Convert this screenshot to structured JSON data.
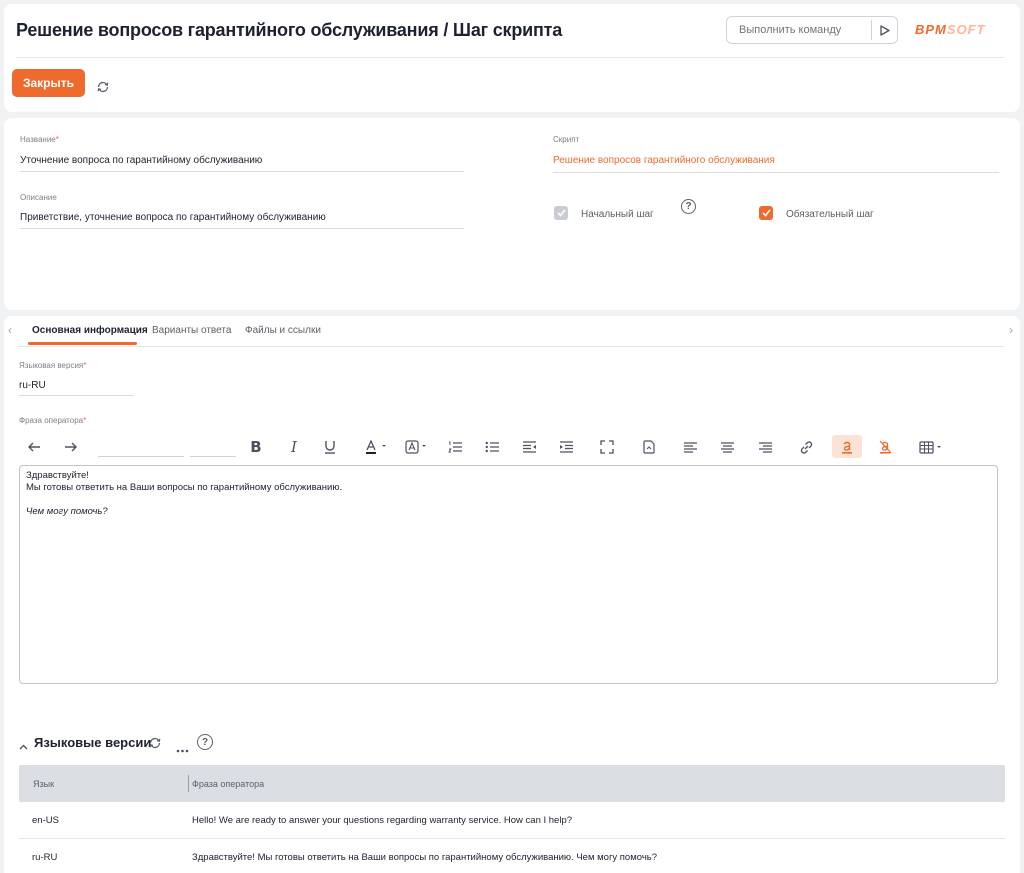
{
  "header": {
    "title": "Решение вопросов гарантийного обслуживания / Шаг скрипта",
    "command_placeholder": "Выполнить команду",
    "logo_main": "ВРМ",
    "logo_soft": "SOFT",
    "close_label": "Закрыть"
  },
  "form": {
    "name_label": "Название",
    "name_value": "Уточнение вопроса по гарантийному обслуживанию",
    "description_label": "Описание",
    "description_value": "Приветствие, уточнение вопроса по гарантийному обслуживанию",
    "script_label": "Скрипт",
    "script_value": "Решение вопросов гарантийного обслуживания",
    "initial_step_label": "Начальный шаг",
    "initial_step_checked": true,
    "mandatory_step_label": "Обязательный шаг",
    "mandatory_step_checked": true,
    "help_glyph": "?"
  },
  "tabs": [
    {
      "label": "Основная информация",
      "active": true
    },
    {
      "label": "Варианты ответа",
      "active": false
    },
    {
      "label": "Файлы и ссылки",
      "active": false
    }
  ],
  "main": {
    "language_label": "Языковая версия",
    "language_value": "ru-RU",
    "phrase_label": "Фраза оператора",
    "editor_line1": "Здравствуйте!",
    "editor_line2": "Мы готовы ответить на Ваши вопросы по гарантийному обслуживанию.",
    "editor_line3": "Чем могу помочь?"
  },
  "toolbar": {
    "icons": [
      "undo-icon",
      "redo-icon",
      "bold-icon",
      "italic-icon",
      "underline-icon",
      "font-color-icon",
      "highlight-icon",
      "numbered-list-icon",
      "bulleted-list-icon",
      "outdent-icon",
      "indent-icon",
      "fullscreen-icon",
      "insert-file-icon",
      "align-left-icon",
      "align-center-icon",
      "align-right-icon",
      "link-icon",
      "text-color-icon",
      "clear-format-icon",
      "table-icon"
    ]
  },
  "language_versions": {
    "title": "Языковые версии",
    "columns": [
      "Язык",
      "Фраза оператора"
    ],
    "rows": [
      {
        "language": "en-US",
        "phrase": "Hello! We are ready to answer your questions regarding warranty service. How can I help?"
      },
      {
        "language": "ru-RU",
        "phrase": "Здравствуйте! Мы готовы ответить на Ваши вопросы по гарантийному обслуживанию. Чем могу помочь?"
      }
    ]
  },
  "colors": {
    "accent": "#ef6b2d",
    "background": "#f1f2f4",
    "grid_header": "#dbdee3"
  }
}
